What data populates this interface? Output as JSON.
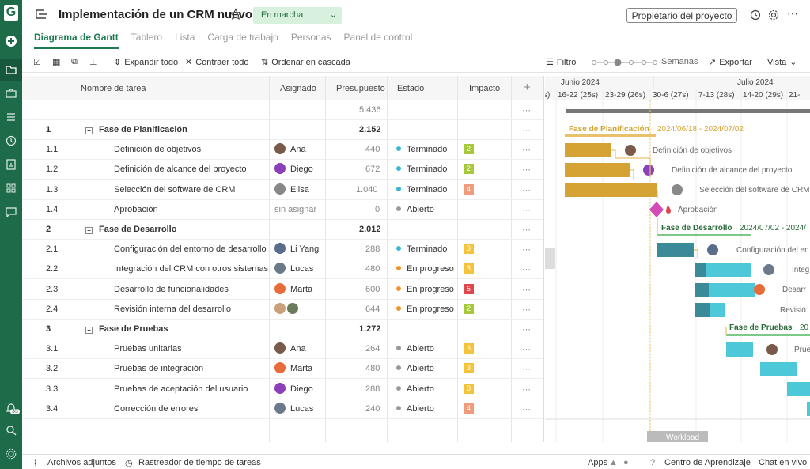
{
  "app": {
    "logo": "G",
    "notif_count": "35"
  },
  "project": {
    "title": "Implementación de un CRM nuevo",
    "status": "En marcha",
    "owner_button": "Propietario del proyecto"
  },
  "tabs": [
    "Diagrama de Gantt",
    "Tablero",
    "Lista",
    "Carga de trabajo",
    "Personas",
    "Panel de control"
  ],
  "toolbar": {
    "expand": "Expandir todo",
    "collapse": "Contraer todo",
    "cascade": "Ordenar en cascada",
    "filter": "Filtro",
    "scale": "Semanas",
    "export": "Exportar",
    "view": "Vista"
  },
  "columns": {
    "name": "Nombre de tarea",
    "assignee": "Asignado",
    "budget": "Presupuesto",
    "status": "Estado",
    "impact": "Impacto",
    "add": "+"
  },
  "total_budget": "5.436",
  "rows": [
    {
      "id": "1",
      "name": "Fase de Planificación",
      "phase": true,
      "budget": "2.152"
    },
    {
      "id": "1.1",
      "name": "Definición de objetivos",
      "assignee": "Ana",
      "budget": "440",
      "status": "Terminado",
      "impact": "2"
    },
    {
      "id": "1.2",
      "name": "Definición de alcance del proyecto",
      "assignee": "Diego",
      "budget": "672",
      "status": "Terminado",
      "impact": "2"
    },
    {
      "id": "1.3",
      "name": "Selección del software de CRM",
      "assignee": "Elisa",
      "budget": "1.040",
      "status": "Terminado",
      "impact": "4"
    },
    {
      "id": "1.4",
      "name": "Aprobación",
      "assignee": "sin asignar",
      "budget": "0",
      "status": "Abierto",
      "impact": ""
    },
    {
      "id": "2",
      "name": "Fase de Desarrollo",
      "phase": true,
      "budget": "2.012"
    },
    {
      "id": "2.1",
      "name": "Configuración del entorno de desarrollo",
      "assignee": "Li Yang",
      "budget": "288",
      "status": "Terminado",
      "impact": "3"
    },
    {
      "id": "2.2",
      "name": "Integración del CRM con otros sistemas",
      "assignee": "Lucas",
      "budget": "480",
      "status": "En progreso",
      "impact": "3"
    },
    {
      "id": "2.3",
      "name": "Desarrollo de funcionalidades",
      "assignee": "Marta",
      "budget": "600",
      "status": "En progreso",
      "impact": "5"
    },
    {
      "id": "2.4",
      "name": "Revisión interna del desarrollo",
      "assignee": "",
      "budget": "644",
      "status": "En progreso",
      "impact": "2"
    },
    {
      "id": "3",
      "name": "Fase de Pruebas",
      "phase": true,
      "budget": "1.272"
    },
    {
      "id": "3.1",
      "name": "Pruebas unitarias",
      "assignee": "Ana",
      "budget": "264",
      "status": "Abierto",
      "impact": "3"
    },
    {
      "id": "3.2",
      "name": "Pruebas de integración",
      "assignee": "Marta",
      "budget": "480",
      "status": "Abierto",
      "impact": "3"
    },
    {
      "id": "3.3",
      "name": "Pruebas de aceptación del usuario",
      "assignee": "Diego",
      "budget": "288",
      "status": "Abierto",
      "impact": "3"
    },
    {
      "id": "3.4",
      "name": "Corrección de errores",
      "assignee": "Lucas",
      "budget": "240",
      "status": "Abierto",
      "impact": "4"
    }
  ],
  "gantt": {
    "months": [
      "Junio 2024",
      "Julio 2024"
    ],
    "weeks": [
      "s)",
      "16-22 (25s)",
      "23-29 (26s)",
      "30-6 (27s)",
      "7-13 (28s)",
      "14-20 (29s)",
      "21-"
    ],
    "phase1": "Fase de Planificación",
    "phase1_dates": "2024/06/18 - 2024/07/02",
    "phase2": "Fase de Desarrollo",
    "phase2_dates": "2024/07/02 - 2024/",
    "phase3": "Fase de Pruebas",
    "phase3_dates": "20",
    "labels": [
      "Definición de objetivos",
      "Definición de alcance del proyecto",
      "Selección del software de CRM",
      "Aprobación",
      "Configuración del en",
      "Integ",
      "Desarr",
      "Revisió",
      "Prue"
    ],
    "workload": "Workload"
  },
  "footer": {
    "attachments": "Archivos adjuntos",
    "tracker": "Rastreador de tiempo de tareas",
    "apps": "Apps",
    "learning": "Centro de Aprendizaje",
    "chat": "Chat en vivo"
  },
  "colors": {
    "brand": "#1e6b4a",
    "plan": "#d4a334",
    "dev": "#3b8a9a",
    "test": "#4cc8d8"
  }
}
